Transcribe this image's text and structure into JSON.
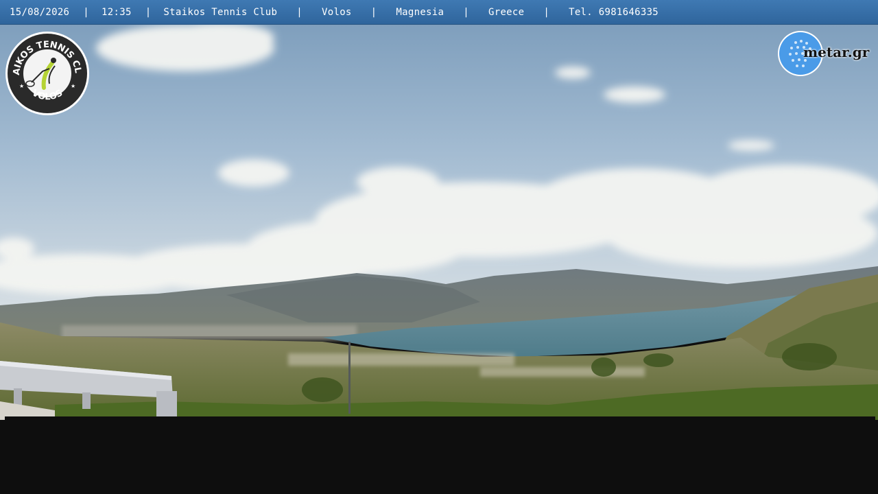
{
  "info_bar": {
    "date": "15/08/2026",
    "time": "12:35",
    "place": "Staikos Tennis Club",
    "city": "Volos",
    "region": "Magnesia",
    "country": "Greece",
    "phone": "Tel. 6981646335",
    "separator": "|",
    "background_color": "#3470a8"
  },
  "club_logo": {
    "top_text": "STAIKOS TENNIS CLUB",
    "bottom_text": "VOLOS",
    "icon": "tennis-player-icon",
    "accent_color": "#b5d334"
  },
  "brand_logo": {
    "text": "metar.gr",
    "icon": "golf-ball-icon",
    "accent_color": "#4a9be8"
  },
  "scene": {
    "subject": "webcam-panorama",
    "sky_color": "#9fb8cf",
    "sea_color": "#5b8593",
    "hill_color": "#6e7a5a"
  }
}
